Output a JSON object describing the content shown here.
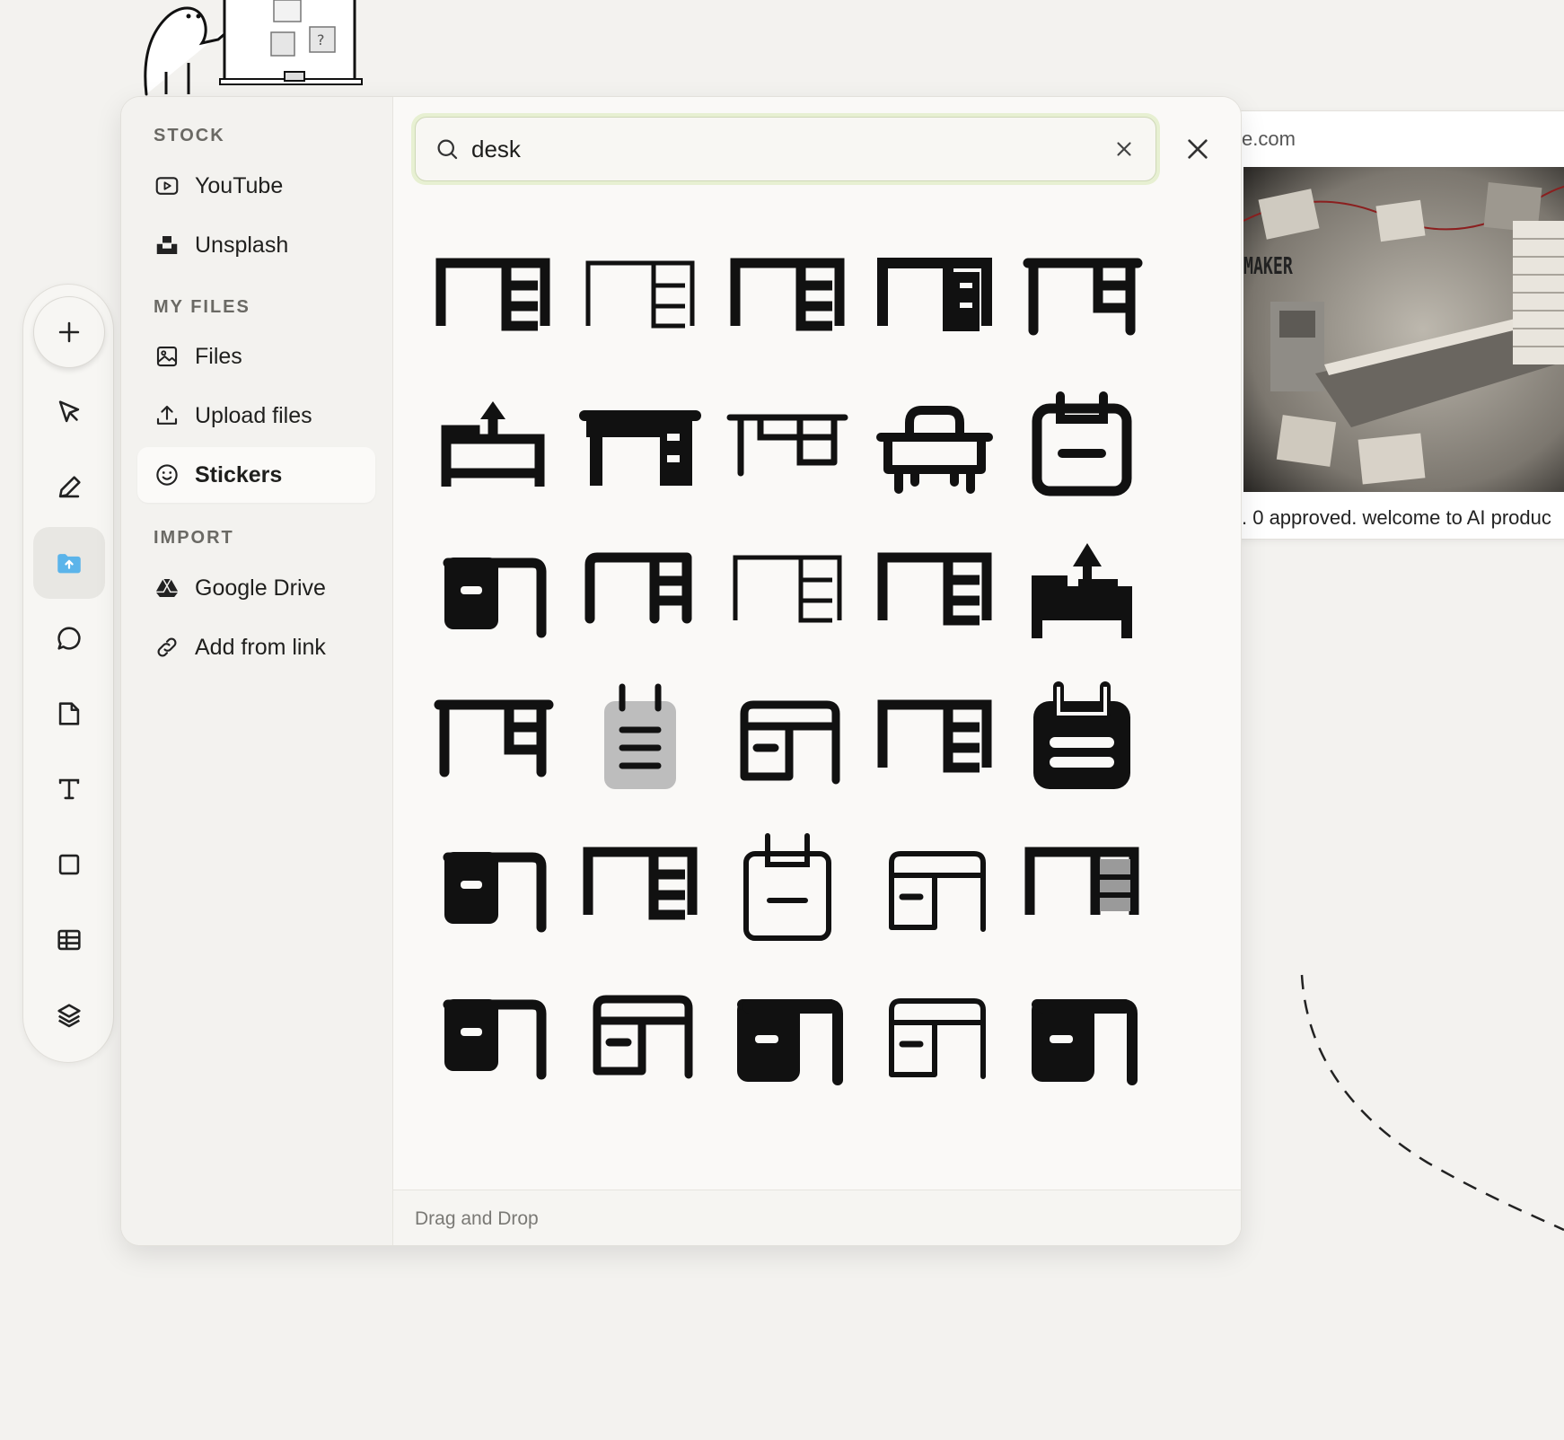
{
  "sidebar": {
    "sections": [
      {
        "title": "STOCK",
        "items": [
          {
            "label": "YouTube",
            "icon": "youtube-icon"
          },
          {
            "label": "Unsplash",
            "icon": "unsplash-icon"
          }
        ]
      },
      {
        "title": "MY FILES",
        "items": [
          {
            "label": "Files",
            "icon": "image-icon"
          },
          {
            "label": "Upload files",
            "icon": "upload-icon"
          },
          {
            "label": "Stickers",
            "icon": "smiley-icon",
            "active": true
          }
        ]
      },
      {
        "title": "IMPORT",
        "items": [
          {
            "label": "Google Drive",
            "icon": "google-drive-icon"
          },
          {
            "label": "Add from link",
            "icon": "link-icon"
          }
        ]
      }
    ]
  },
  "search": {
    "value": "desk",
    "placeholder": ""
  },
  "footer": {
    "text": "Drag and Drop"
  },
  "background_card": {
    "url_text": "e.com",
    "caption": ". 0 approved. welcome to AI produc",
    "image_text": "MAKER"
  },
  "toolbar": {
    "tools": [
      "plus-icon",
      "pointer-icon",
      "pen-icon",
      "folder-upload-icon",
      "comment-icon",
      "note-icon",
      "text-icon",
      "rectangle-icon",
      "table-icon",
      "layers-icon"
    ],
    "active": "folder-upload-icon"
  },
  "stickers": [
    "desk-drawers",
    "desk-drawers-thin",
    "desk-drawers",
    "desk-drawers-bold",
    "desk-drawers-wide",
    "desk-lamp-outline",
    "desk-solid",
    "desk-wide-thin",
    "school-desk",
    "notepad-outline",
    "desk-drawer-left-solid",
    "desk-drawers-rounded",
    "desk-drawers-thin",
    "desk-drawers",
    "desk-lamp-solid",
    "desk-drawers-wide",
    "notepad-gray",
    "desk-drawer-left-outline",
    "desk-drawers",
    "notepad-solid",
    "desk-drawer-left-solid",
    "desk-drawers",
    "notepad-thin",
    "desk-drawer-left-thin",
    "desk-drawers-gray",
    "desk-drawer-left-solid",
    "desk-drawer-left-outline",
    "desk-drawer-left-solid-full",
    "desk-drawer-left-thin",
    "desk-drawer-left-solid-full"
  ],
  "colors": {
    "accent_ring": "#e7f0d2",
    "background": "#f3f2ef",
    "panel": "#faf9f7"
  }
}
